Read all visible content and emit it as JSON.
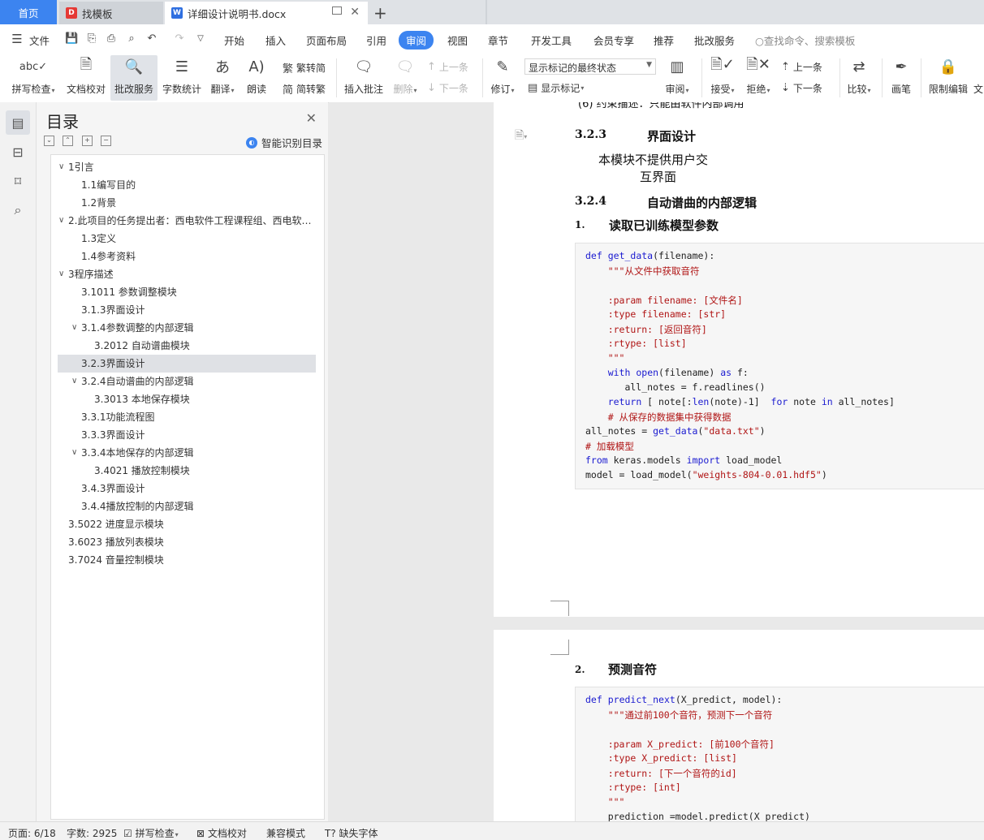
{
  "tabs": {
    "home": "首页",
    "template": "找模板",
    "document": "详细设计说明书.docx"
  },
  "menu": {
    "file": "文件",
    "items": [
      "开始",
      "插入",
      "页面布局",
      "引用",
      "审阅",
      "视图",
      "章节",
      "开发工具",
      "会员专享",
      "推荐",
      "批改服务"
    ],
    "active": "审阅",
    "search_placeholder": "查找命令、搜索模板"
  },
  "ribbon": {
    "spellcheck": "拼写检查",
    "doc_proof": "文档校对",
    "review_service": "批改服务",
    "word_count": "字数统计",
    "translate": "翻译",
    "read_aloud": "朗读",
    "to_traditional": "繁转简",
    "to_simplified": "简转繁",
    "insert_comment": "插入批注",
    "delete": "删除",
    "prev_comment": "上一条",
    "next_comment": "下一条",
    "revise": "修订",
    "markup_state": "显示标记的最终状态",
    "show_markup": "显示标记",
    "review_pane": "审阅",
    "accept": "接受",
    "reject": "拒绝",
    "prev_change": "上一条",
    "next_change": "下一条",
    "compare": "比较",
    "pen": "画笔",
    "restrict_edit": "限制编辑",
    "cut_off": "文"
  },
  "toc": {
    "title": "目录",
    "smart_recognize": "智能识别目录",
    "items": [
      {
        "text": "1引言",
        "level": 0,
        "arrow": true
      },
      {
        "text": "1.1编写目的",
        "level": 1,
        "arrow": false
      },
      {
        "text": "1.2背景",
        "level": 1,
        "arrow": false
      },
      {
        "text": "2.此项目的任务提出者：西电软件工程课程组、西电软…",
        "level": 0,
        "arrow": true
      },
      {
        "text": "1.3定义",
        "level": 1,
        "arrow": false
      },
      {
        "text": "1.4参考资料",
        "level": 1,
        "arrow": false
      },
      {
        "text": "3程序描述",
        "level": 0,
        "arrow": true
      },
      {
        "text": "3.1011 参数调整模块",
        "level": 1,
        "arrow": false
      },
      {
        "text": "3.1.3界面设计",
        "level": 1,
        "arrow": false
      },
      {
        "text": "3.1.4参数调整的内部逻辑",
        "level": 1,
        "arrow": true
      },
      {
        "text": "3.2012 自动谱曲模块",
        "level": 2,
        "arrow": false
      },
      {
        "text": "3.2.3界面设计",
        "level": 1,
        "arrow": false,
        "selected": true
      },
      {
        "text": "3.2.4自动谱曲的内部逻辑",
        "level": 1,
        "arrow": true
      },
      {
        "text": "3.3013 本地保存模块",
        "level": 2,
        "arrow": false
      },
      {
        "text": "3.3.1功能流程图",
        "level": 1,
        "arrow": false
      },
      {
        "text": "3.3.3界面设计",
        "level": 1,
        "arrow": false
      },
      {
        "text": "3.3.4本地保存的内部逻辑",
        "level": 1,
        "arrow": true
      },
      {
        "text": "3.4021 播放控制模块",
        "level": 2,
        "arrow": false
      },
      {
        "text": "3.4.3界面设计",
        "level": 1,
        "arrow": false
      },
      {
        "text": "3.4.4播放控制的内部逻辑",
        "level": 1,
        "arrow": false
      },
      {
        "text": "3.5022 进度显示模块",
        "level": 0,
        "arrow": false
      },
      {
        "text": "3.6023 播放列表模块",
        "level": 0,
        "arrow": false
      },
      {
        "text": "3.7024 音量控制模块",
        "level": 0,
        "arrow": false
      }
    ]
  },
  "document": {
    "cut_line": "(6)  约束描述：只能由软件内部调用",
    "h323_num": "3.2.3",
    "h323_text": "界面设计",
    "body1": "本模块不提供用户交",
    "body2": "互界面",
    "h324_num": "3.2.4",
    "h324_text": "自动谱曲的内部逻辑",
    "item1_num": "1.",
    "item1_text": "读取已训练模型参数",
    "item2_num": "2.",
    "item2_text": "预测音符",
    "code1": [
      "def get_data(filename):",
      "    \"\"\"从文件中获取音符",
      "",
      "    :param filename: [文件名]",
      "    :type filename: [str]",
      "    :return: [返回音符]",
      "    :rtype: [list]",
      "    \"\"\"",
      "    with open(filename) as f:",
      "       all_notes = f.readlines()",
      "    return [ note[:len(note)-1]  for note in all_notes]",
      "    # 从保存的数据集中获得数据",
      "all_notes = get_data(\"data.txt\")",
      "# 加载模型",
      "from keras.models import load_model",
      "model = load_model(\"weights-804-0.01.hdf5\")"
    ],
    "code2": [
      "def predict_next(X_predict, model):",
      "    \"\"\"通过前100个音符，预测下一个音符",
      "",
      "    :param X_predict: [前100个音符]",
      "    :type X_predict: [list]",
      "    :return: [下一个音符的id]",
      "    :rtype: [int]",
      "    \"\"\"",
      "    prediction =model.predict(X_predict)"
    ]
  },
  "status": {
    "page": "页面: 6/18",
    "words": "字数: 2925",
    "spellcheck": "拼写检查",
    "doc_proof": "文档校对",
    "compat": "兼容模式",
    "missing_font": "缺失字体"
  },
  "colors": {
    "accent": "#3c84f0",
    "keyword": "#1a1ad0",
    "string": "#b01515"
  }
}
